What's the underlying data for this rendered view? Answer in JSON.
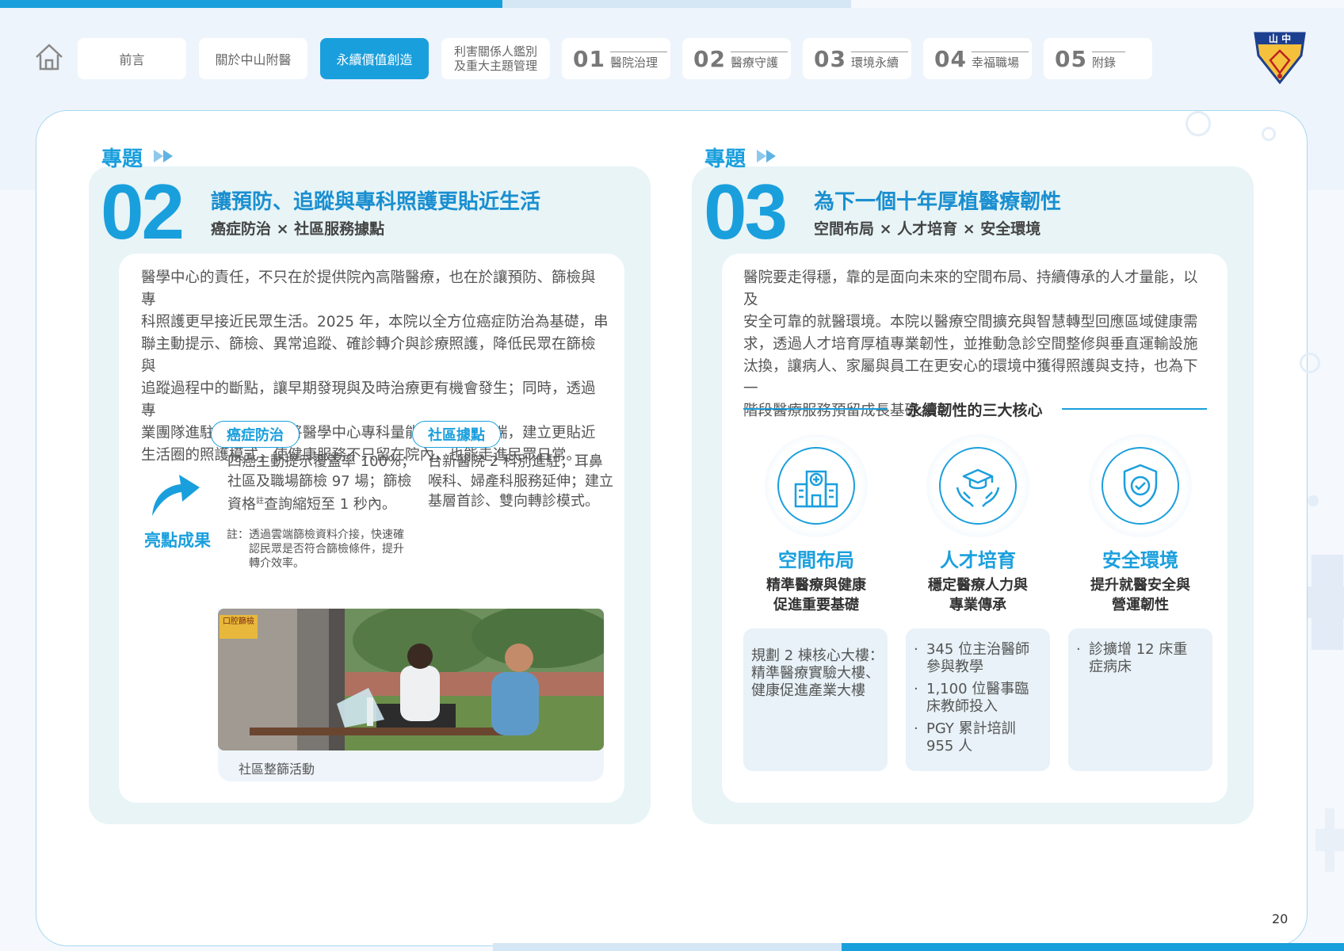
{
  "nav": {
    "items": [
      {
        "label": "前言"
      },
      {
        "label": "關於中山附醫"
      },
      {
        "label": "永續價值創造"
      },
      {
        "label1": "利害關係人鑑別",
        "label2": "及重大主題管理"
      },
      {
        "num": "01",
        "label": "醫院治理"
      },
      {
        "num": "02",
        "label": "醫療守護"
      },
      {
        "num": "03",
        "label": "環境永續"
      },
      {
        "num": "04",
        "label": "幸福職場"
      },
      {
        "num": "05",
        "label": "附錄"
      }
    ],
    "logo_text": "山 中"
  },
  "colors": {
    "accent": "#1a9fdd",
    "panel": "#e8f4f6"
  },
  "topic2": {
    "label": "專題",
    "num": "02",
    "title": "讓預防、追蹤與專科照護更貼近生活",
    "subtitle": "癌症防治 × 社區服務據點",
    "para_lines": [
      "醫學中心的責任，不只在於提供院內高階醫療，也在於讓預防、篩檢與專",
      "科照護更早接近民眾生活。2025 年，本院以全方位癌症防治為基礎，串",
      "聯主動提示、篩檢、異常追蹤、確診轉介與診療照護，降低民眾在篩檢與",
      "追蹤過程中的斷點，讓早期發現與及時治療更有機會發生；同時，透過專",
      "業團隊進駐台新醫院，將醫學中心專科量能延伸至社區端，建立更貼近",
      "生活圈的照護模式，使健康服務不只留在院內，也能走進民眾日常。"
    ],
    "tag_cancer": "癌症防治",
    "tag_community": "社區據點",
    "cancer_lines": [
      "四癌主動提示覆蓋率 100%；",
      "社區及職場篩檢 97 場；篩檢"
    ],
    "cancer_line3_a": "資格",
    "cancer_line3_sup": "註",
    "cancer_line3_b": "查詢縮短至 1 秒內。",
    "community_lines": [
      "台新醫院 2 科別進駐；耳鼻",
      "喉科、婦產科服務延伸；建立",
      "基層首診、雙向轉診模式。"
    ],
    "highlight": "亮點成果",
    "note_prefix": "註：",
    "note_lines": [
      "透過雲端篩檢資料介接，快速確",
      "認民眾是否符合篩檢條件，提升",
      "轉介效率。"
    ],
    "photo_sign": "口腔篩檢",
    "caption": "社區整篩活動"
  },
  "topic3": {
    "label": "專題",
    "num": "03",
    "title": "為下一個十年厚植醫療韌性",
    "subtitle": "空間布局 × 人才培育 × 安全環境",
    "para_lines": [
      "醫院要走得穩，靠的是面向未來的空間布局、持續傳承的人才量能，以及",
      "安全可靠的就醫環境。本院以醫療空間擴充與智慧轉型回應區域健康需",
      "求，透過人才培育厚植專業韌性，並推動急診空間整修與垂直運輸設施",
      "汰換，讓病人、家屬與員工在更安心的環境中獲得照護與支持，也為下一",
      "階段醫療服務預留成長基礎。"
    ],
    "core_title": "永續韌性的三大核心",
    "cores": [
      {
        "name": "空間布局",
        "desc1": "精準醫療與健康",
        "desc2": "促進重要基礎",
        "icon": "hospital-icon",
        "lines": [
          "規劃 2 棟核心大樓：",
          "精準醫療實驗大樓、",
          "健康促進產業大樓"
        ]
      },
      {
        "name": "人才培育",
        "desc1": "穩定醫療人力與",
        "desc2": "專業傳承",
        "icon": "graduation-hands-icon",
        "bullets": [
          [
            "345 位主治醫師",
            "參與教學"
          ],
          [
            "1,100 位醫事臨",
            "床教師投入"
          ],
          [
            "PGY 累計培訓",
            "955 人"
          ]
        ]
      },
      {
        "name": "安全環境",
        "desc1": "提升就醫安全與",
        "desc2": "營運韌性",
        "icon": "shield-check-icon",
        "bullets": [
          [
            "診擴增 12 床重",
            "症病床"
          ]
        ]
      }
    ]
  },
  "bullet_char": "·",
  "page_number": "20"
}
